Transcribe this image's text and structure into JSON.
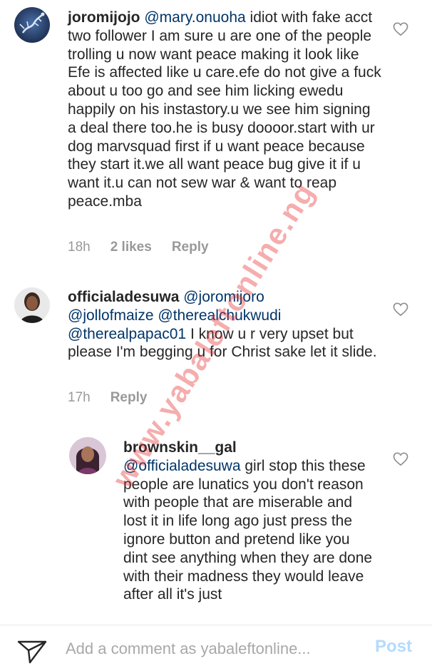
{
  "comments": [
    {
      "username": "joromijojo",
      "mentions": [
        "@mary.onuoha"
      ],
      "text": " idiot with fake acct two follower I am sure u are one of the people trolling u now want peace making it look like Efe is affected like u care.efe do not give a fuck about u too go and see him licking ewedu happily on his instastory.u we see him signing a deal there too.he is busy doooor.start with ur dog marvsquad first if u want peace because they start it.we all want peace bug give it if u want it.u can not sew war & want to reap peace.mba",
      "time": "18h",
      "likes": "2 likes",
      "reply_label": "Reply"
    },
    {
      "username": "officialadesuwa",
      "mentions": [
        "@joromijoro",
        "@jollofmaize",
        "@therealchukwudi",
        "@therealpapac01"
      ],
      "text": " I know u r very upset but please I'm begging u for Christ sake let it slide.",
      "time": "17h",
      "reply_label": "Reply"
    },
    {
      "username": "brownskin__gal",
      "mentions": [
        "@officialadesuwa"
      ],
      "text": " girl stop this these people are lunatics you don't reason with people that are miserable and lost it in life long ago just press the ignore button and pretend like you dint see anything when they are done with their madness they would leave after all it's just"
    }
  ],
  "watermark": "www.yabaleftonline.ng",
  "composer": {
    "placeholder": "Add a comment as yabaleftonline...",
    "post_label": "Post"
  },
  "colors": {
    "mention": "#003569",
    "meta": "#999999",
    "post_disabled": "#b3dbff",
    "watermark": "#e62828"
  },
  "icons": {
    "like": "heart-outline-icon",
    "share": "paper-plane-icon"
  }
}
